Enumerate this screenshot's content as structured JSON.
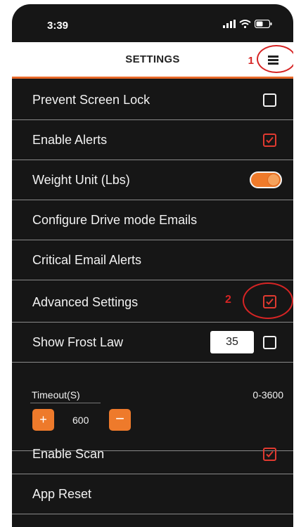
{
  "status_bar": {
    "time": "3:39"
  },
  "header": {
    "title": "SETTINGS",
    "annotation": "1"
  },
  "settings": {
    "prevent_screen_lock": {
      "label": "Prevent Screen Lock",
      "checked": false
    },
    "enable_alerts": {
      "label": "Enable Alerts",
      "checked": true
    },
    "weight_unit": {
      "label": "Weight Unit (Lbs)",
      "on": true
    },
    "configure_drive_mode": {
      "label": "Configure Drive mode Emails"
    },
    "critical_email_alerts": {
      "label": "Critical Email Alerts"
    },
    "advanced_settings": {
      "label": "Advanced Settings",
      "checked": true,
      "annotation": "2"
    },
    "show_frost_law": {
      "label": "Show Frost Law",
      "value": "35",
      "checked": false
    },
    "timeout": {
      "label": "Timeout(S)",
      "range": "0-3600",
      "value": "600",
      "plus": "+",
      "minus": "−"
    },
    "enable_scan": {
      "label": "Enable Scan",
      "checked": true
    },
    "app_reset": {
      "label": "App Reset"
    }
  },
  "colors": {
    "accent": "#ee7a2b",
    "annotation": "#d62424",
    "background": "#161616"
  }
}
